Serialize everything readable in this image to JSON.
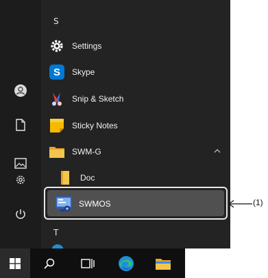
{
  "start_menu": {
    "user_icon": "person-icon",
    "rail_icons": [
      "person-icon",
      "document-icon",
      "pictures-icon",
      "gear-icon",
      "power-icon"
    ],
    "app_list": {
      "section_s_letter": "S",
      "items": [
        {
          "label": "Settings",
          "icon": "gear-icon"
        },
        {
          "label": "Skype",
          "icon": "skype-icon"
        },
        {
          "label": "Snip & Sketch",
          "icon": "snip-sketch-icon"
        },
        {
          "label": "Sticky Notes",
          "icon": "sticky-notes-icon"
        },
        {
          "label": "SWM-G",
          "icon": "folder-icon",
          "expanded": true
        },
        {
          "label": "Doc",
          "icon": "folder-icon"
        },
        {
          "label": "SWMOS",
          "icon": "swmos-app-icon",
          "highlighted": true
        }
      ],
      "section_t_letter": "T"
    }
  },
  "taskbar": {
    "icons": [
      "windows-start-icon",
      "search-icon",
      "task-view-icon",
      "edge-icon",
      "file-explorer-icon"
    ]
  },
  "callout": {
    "label": "(1)"
  },
  "colors": {
    "menu_bg": "#232323",
    "rail_bg": "#1c1c1c",
    "taskbar_bg": "#0f0f0f",
    "highlight_bg": "#505050",
    "text": "#f2f2f2",
    "skype_blue": "#0078d4",
    "folder_yellow": "#f4c54a"
  }
}
